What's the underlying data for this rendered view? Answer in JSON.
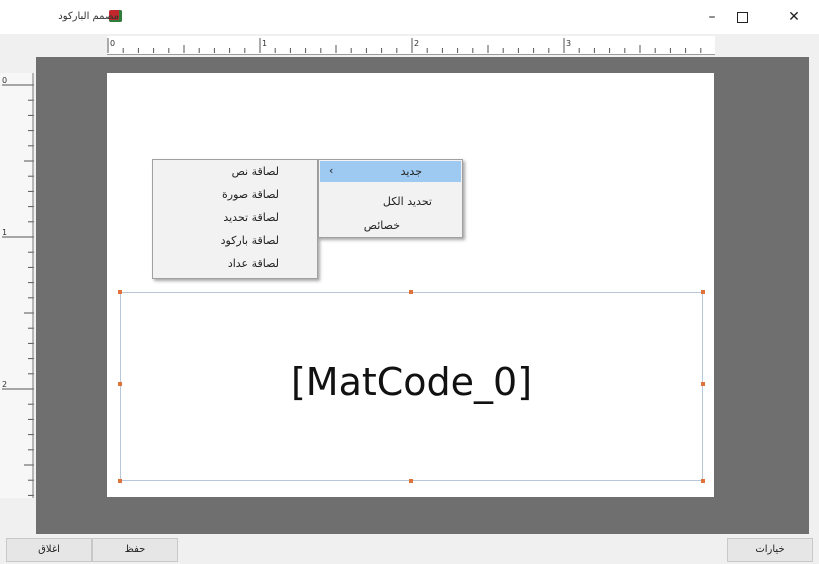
{
  "window": {
    "title": "مصمم الباركود",
    "minimize_icon": "minimize-icon",
    "maximize_icon": "maximize-icon",
    "close_icon": "close-icon",
    "minimize_glyph": "–",
    "close_glyph": "✕"
  },
  "rulers": {
    "horizontal_labels": [
      "0",
      "1",
      "2",
      "3"
    ],
    "vertical_labels": [
      "0",
      "1",
      "2"
    ]
  },
  "canvas": {
    "element_text": "[MatCode_0]"
  },
  "context_menu": {
    "items": [
      {
        "label": "جديد",
        "highlighted": true,
        "submenu_arrow": "›"
      },
      {
        "label": "تحديد الكل"
      },
      {
        "label": "خصائص"
      }
    ]
  },
  "submenu": {
    "items": [
      {
        "label": "لصاقة نص"
      },
      {
        "label": "لصاقة صورة"
      },
      {
        "label": "لصاقة تحديد"
      },
      {
        "label": "لصاقة باركود"
      },
      {
        "label": "لصاقة عداد"
      }
    ]
  },
  "buttons": {
    "close_label": "اغلاق",
    "save_label": "حفظ",
    "options_label": "خيارات"
  },
  "colors": {
    "workspace": "#6f6f6f",
    "menu_highlight": "#9ec9f0",
    "handle": "#e0733a"
  }
}
